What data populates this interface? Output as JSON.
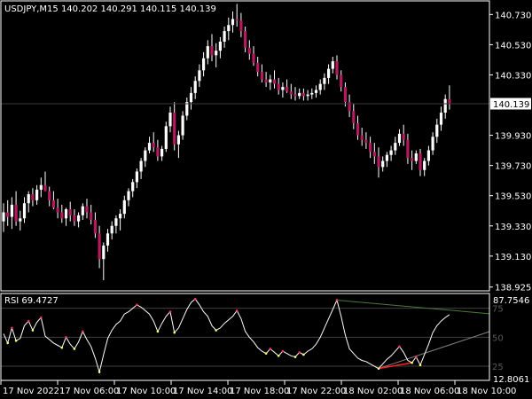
{
  "colors": {
    "background": "#000000",
    "frame": "#ffffff",
    "bull_wick": "#ffffff",
    "bull_body": "#ffffff",
    "bear_body": "#b7195f",
    "price_line": "#3a3a3a",
    "rsi_line": "#ffffff",
    "rsi_levels": "#404040",
    "rsi_level_text": "#5a5a5a",
    "dot_overbought": "#ff3366",
    "dot_oversold": "#ffff66",
    "trend_support": "#ff2020",
    "trend_resistance": "#4a7a3a",
    "trend_lower": "#808080"
  },
  "price_panel": {
    "header": "USDJPY,M15  140.202 140.291 140.115 140.139",
    "current_price": "140.139",
    "y_ticks": [
      "140.730",
      "140.530",
      "140.330",
      "140.139",
      "139.930",
      "139.730",
      "139.530",
      "139.330",
      "139.130",
      "138.925"
    ]
  },
  "rsi_panel": {
    "header": "RSI 69.4727",
    "scale_max": "87.7546",
    "scale_min": "12.8061",
    "levels": [
      "75",
      "50",
      "25"
    ]
  },
  "time_axis": {
    "labels": [
      "17 Nov 2022",
      "17 Nov 06:00",
      "17 Nov 10:00",
      "17 Nov 14:00",
      "17 Nov 18:00",
      "17 Nov 22:00",
      "18 Nov 02:00",
      "18 Nov 06:00",
      "18 Nov 10:00"
    ]
  },
  "chart_data": [
    {
      "type": "candlestick",
      "title": "USDJPY,M15",
      "ylim": [
        138.9,
        140.82
      ],
      "y_ticks": [
        140.73,
        140.53,
        140.33,
        140.139,
        139.93,
        139.73,
        139.53,
        139.33,
        139.13,
        138.925
      ],
      "current_price": 140.139,
      "ohlc": [
        [
          139.36,
          139.48,
          139.29,
          139.42
        ],
        [
          139.42,
          139.5,
          139.33,
          139.39
        ],
        [
          139.39,
          139.52,
          139.31,
          139.47
        ],
        [
          139.47,
          139.56,
          139.33,
          139.36
        ],
        [
          139.36,
          139.43,
          139.3,
          139.38
        ],
        [
          139.38,
          139.52,
          139.35,
          139.48
        ],
        [
          139.48,
          139.56,
          139.42,
          139.54
        ],
        [
          139.54,
          139.58,
          139.46,
          139.5
        ],
        [
          139.5,
          139.6,
          139.47,
          139.57
        ],
        [
          139.57,
          139.65,
          139.52,
          139.6
        ],
        [
          139.6,
          139.69,
          139.56,
          139.56
        ],
        [
          139.56,
          139.59,
          139.46,
          139.5
        ],
        [
          139.5,
          139.56,
          139.44,
          139.45
        ],
        [
          139.45,
          139.51,
          139.38,
          139.42
        ],
        [
          139.42,
          139.47,
          139.35,
          139.38
        ],
        [
          139.38,
          139.45,
          139.33,
          139.44
        ],
        [
          139.44,
          139.49,
          139.36,
          139.4
        ],
        [
          139.4,
          139.44,
          139.33,
          139.36
        ],
        [
          139.36,
          139.42,
          139.32,
          139.4
        ],
        [
          139.4,
          139.48,
          139.37,
          139.46
        ],
        [
          139.46,
          139.51,
          139.38,
          139.42
        ],
        [
          139.42,
          139.47,
          139.34,
          139.37
        ],
        [
          139.37,
          139.42,
          139.25,
          139.28
        ],
        [
          139.28,
          139.33,
          139.05,
          139.11
        ],
        [
          139.11,
          139.22,
          138.97,
          139.2
        ],
        [
          139.2,
          139.31,
          139.16,
          139.28
        ],
        [
          139.28,
          139.36,
          139.24,
          139.33
        ],
        [
          139.33,
          139.4,
          139.28,
          139.38
        ],
        [
          139.38,
          139.44,
          139.3,
          139.41
        ],
        [
          139.41,
          139.53,
          139.38,
          139.5
        ],
        [
          139.5,
          139.58,
          139.46,
          139.56
        ],
        [
          139.56,
          139.64,
          139.52,
          139.62
        ],
        [
          139.62,
          139.71,
          139.58,
          139.69
        ],
        [
          139.69,
          139.78,
          139.64,
          139.76
        ],
        [
          139.76,
          139.85,
          139.72,
          139.83
        ],
        [
          139.83,
          139.92,
          139.81,
          139.88
        ],
        [
          139.88,
          139.95,
          139.82,
          139.85
        ],
        [
          139.85,
          139.9,
          139.76,
          139.79
        ],
        [
          139.79,
          139.86,
          139.76,
          139.84
        ],
        [
          139.84,
          140.02,
          139.82,
          139.99
        ],
        [
          139.99,
          140.12,
          139.95,
          140.08
        ],
        [
          140.08,
          140.15,
          139.83,
          139.87
        ],
        [
          139.87,
          139.96,
          139.78,
          139.93
        ],
        [
          139.93,
          140.09,
          139.9,
          140.06
        ],
        [
          140.06,
          140.18,
          140.03,
          140.15
        ],
        [
          140.15,
          140.25,
          140.1,
          140.21
        ],
        [
          140.21,
          140.32,
          140.17,
          140.29
        ],
        [
          140.29,
          140.4,
          140.25,
          140.36
        ],
        [
          140.36,
          140.48,
          140.32,
          140.44
        ],
        [
          140.44,
          140.56,
          140.4,
          140.52
        ],
        [
          140.52,
          140.6,
          140.42,
          140.46
        ],
        [
          140.46,
          140.54,
          140.38,
          140.49
        ],
        [
          140.49,
          140.58,
          140.44,
          140.55
        ],
        [
          140.55,
          140.65,
          140.51,
          140.62
        ],
        [
          140.62,
          140.71,
          140.56,
          140.66
        ],
        [
          140.66,
          140.75,
          140.61,
          140.7
        ],
        [
          140.7,
          140.8,
          140.65,
          140.69
        ],
        [
          140.69,
          140.74,
          140.58,
          140.62
        ],
        [
          140.62,
          140.65,
          140.48,
          140.51
        ],
        [
          140.51,
          140.56,
          140.43,
          140.47
        ],
        [
          140.47,
          140.52,
          140.39,
          140.41
        ],
        [
          140.41,
          140.45,
          140.32,
          140.35
        ],
        [
          140.35,
          140.4,
          140.28,
          140.3
        ],
        [
          140.3,
          140.35,
          140.25,
          140.28
        ],
        [
          140.28,
          140.33,
          140.23,
          140.3
        ],
        [
          140.3,
          140.36,
          140.24,
          140.27
        ],
        [
          140.27,
          140.31,
          140.2,
          140.23
        ],
        [
          140.23,
          140.28,
          140.18,
          140.25
        ],
        [
          140.25,
          140.3,
          140.21,
          140.22
        ],
        [
          140.22,
          140.27,
          140.17,
          140.2
        ],
        [
          140.2,
          140.25,
          140.16,
          140.19
        ],
        [
          140.19,
          140.24,
          140.17,
          140.21
        ],
        [
          140.21,
          140.24,
          140.16,
          140.19
        ],
        [
          140.19,
          140.23,
          140.16,
          140.2
        ],
        [
          140.2,
          140.24,
          140.17,
          140.21
        ],
        [
          140.21,
          140.26,
          140.18,
          140.23
        ],
        [
          140.23,
          140.3,
          140.2,
          140.27
        ],
        [
          140.27,
          140.34,
          140.23,
          140.31
        ],
        [
          140.31,
          140.4,
          140.27,
          140.37
        ],
        [
          140.37,
          140.45,
          140.34,
          140.42
        ],
        [
          140.42,
          140.46,
          140.3,
          140.33
        ],
        [
          140.33,
          140.36,
          140.22,
          140.25
        ],
        [
          140.25,
          140.28,
          140.12,
          140.15
        ],
        [
          140.15,
          140.2,
          140.05,
          140.09
        ],
        [
          140.09,
          140.14,
          139.97,
          140.01
        ],
        [
          140.01,
          140.06,
          139.9,
          139.93
        ],
        [
          139.93,
          139.98,
          139.86,
          139.9
        ],
        [
          139.9,
          139.95,
          139.84,
          139.88
        ],
        [
          139.88,
          139.92,
          139.78,
          139.82
        ],
        [
          139.82,
          139.88,
          139.74,
          139.79
        ],
        [
          139.79,
          139.85,
          139.65,
          139.72
        ],
        [
          139.72,
          139.79,
          139.69,
          139.76
        ],
        [
          139.76,
          139.82,
          139.72,
          139.8
        ],
        [
          139.8,
          139.86,
          139.76,
          139.83
        ],
        [
          139.83,
          139.92,
          139.8,
          139.88
        ],
        [
          139.88,
          139.97,
          139.86,
          139.94
        ],
        [
          139.94,
          140.0,
          139.86,
          139.9
        ],
        [
          139.9,
          139.94,
          139.74,
          139.78
        ],
        [
          139.78,
          139.83,
          139.7,
          139.76
        ],
        [
          139.76,
          139.83,
          139.74,
          139.81
        ],
        [
          139.81,
          139.84,
          139.66,
          139.7
        ],
        [
          139.7,
          139.78,
          139.66,
          139.76
        ],
        [
          139.76,
          139.86,
          139.73,
          139.83
        ],
        [
          139.83,
          139.95,
          139.8,
          139.92
        ],
        [
          139.92,
          140.04,
          139.88,
          140.0
        ],
        [
          140.0,
          140.12,
          139.96,
          140.08
        ],
        [
          140.08,
          140.2,
          140.04,
          140.17
        ],
        [
          140.17,
          140.26,
          140.1,
          140.139
        ]
      ]
    },
    {
      "type": "line",
      "title": "RSI",
      "ylim": [
        12.8061,
        87.7546
      ],
      "levels": [
        75,
        50,
        25
      ],
      "current_value": 69.4727,
      "series": [
        {
          "values": [
            53.0,
            45.0,
            58.0,
            47.0,
            49.0,
            60.0,
            64.0,
            56.0,
            63.0,
            67.0,
            51.0,
            48.0,
            45.0,
            43.0,
            41.0,
            50.0,
            44.0,
            40.0,
            46.0,
            55.0,
            48.0,
            42.0,
            32.0,
            20.0,
            35.0,
            49.0,
            56.0,
            61.0,
            64.0,
            70.0,
            72.0,
            75.0,
            78.0,
            76.0,
            73.0,
            70.0,
            64.0,
            55.0,
            62.0,
            68.0,
            72.0,
            54.0,
            58.0,
            66.0,
            74.0,
            80.0,
            83.0,
            78.0,
            72.0,
            68.0,
            60.0,
            56.0,
            58.0,
            62.0,
            65.0,
            68.0,
            73.0,
            66.0,
            55.0,
            50.0,
            46.0,
            41.0,
            38.0,
            36.0,
            40.0,
            37.0,
            34.0,
            38.0,
            36.0,
            34.0,
            33.0,
            37.0,
            35.0,
            38.0,
            40.0,
            44.0,
            50.0,
            58.0,
            66.0,
            74.0,
            82.0,
            68.0,
            52.0,
            40.0,
            36.0,
            32.0,
            30.0,
            29.0,
            27.0,
            25.0,
            23.0,
            27.0,
            31.0,
            34.0,
            38.0,
            42.0,
            37.0,
            30.0,
            28.0,
            33.0,
            26.0,
            35.0,
            44.0,
            54.0,
            60.0,
            64.0,
            67.0,
            69.4727
          ]
        }
      ]
    }
  ]
}
